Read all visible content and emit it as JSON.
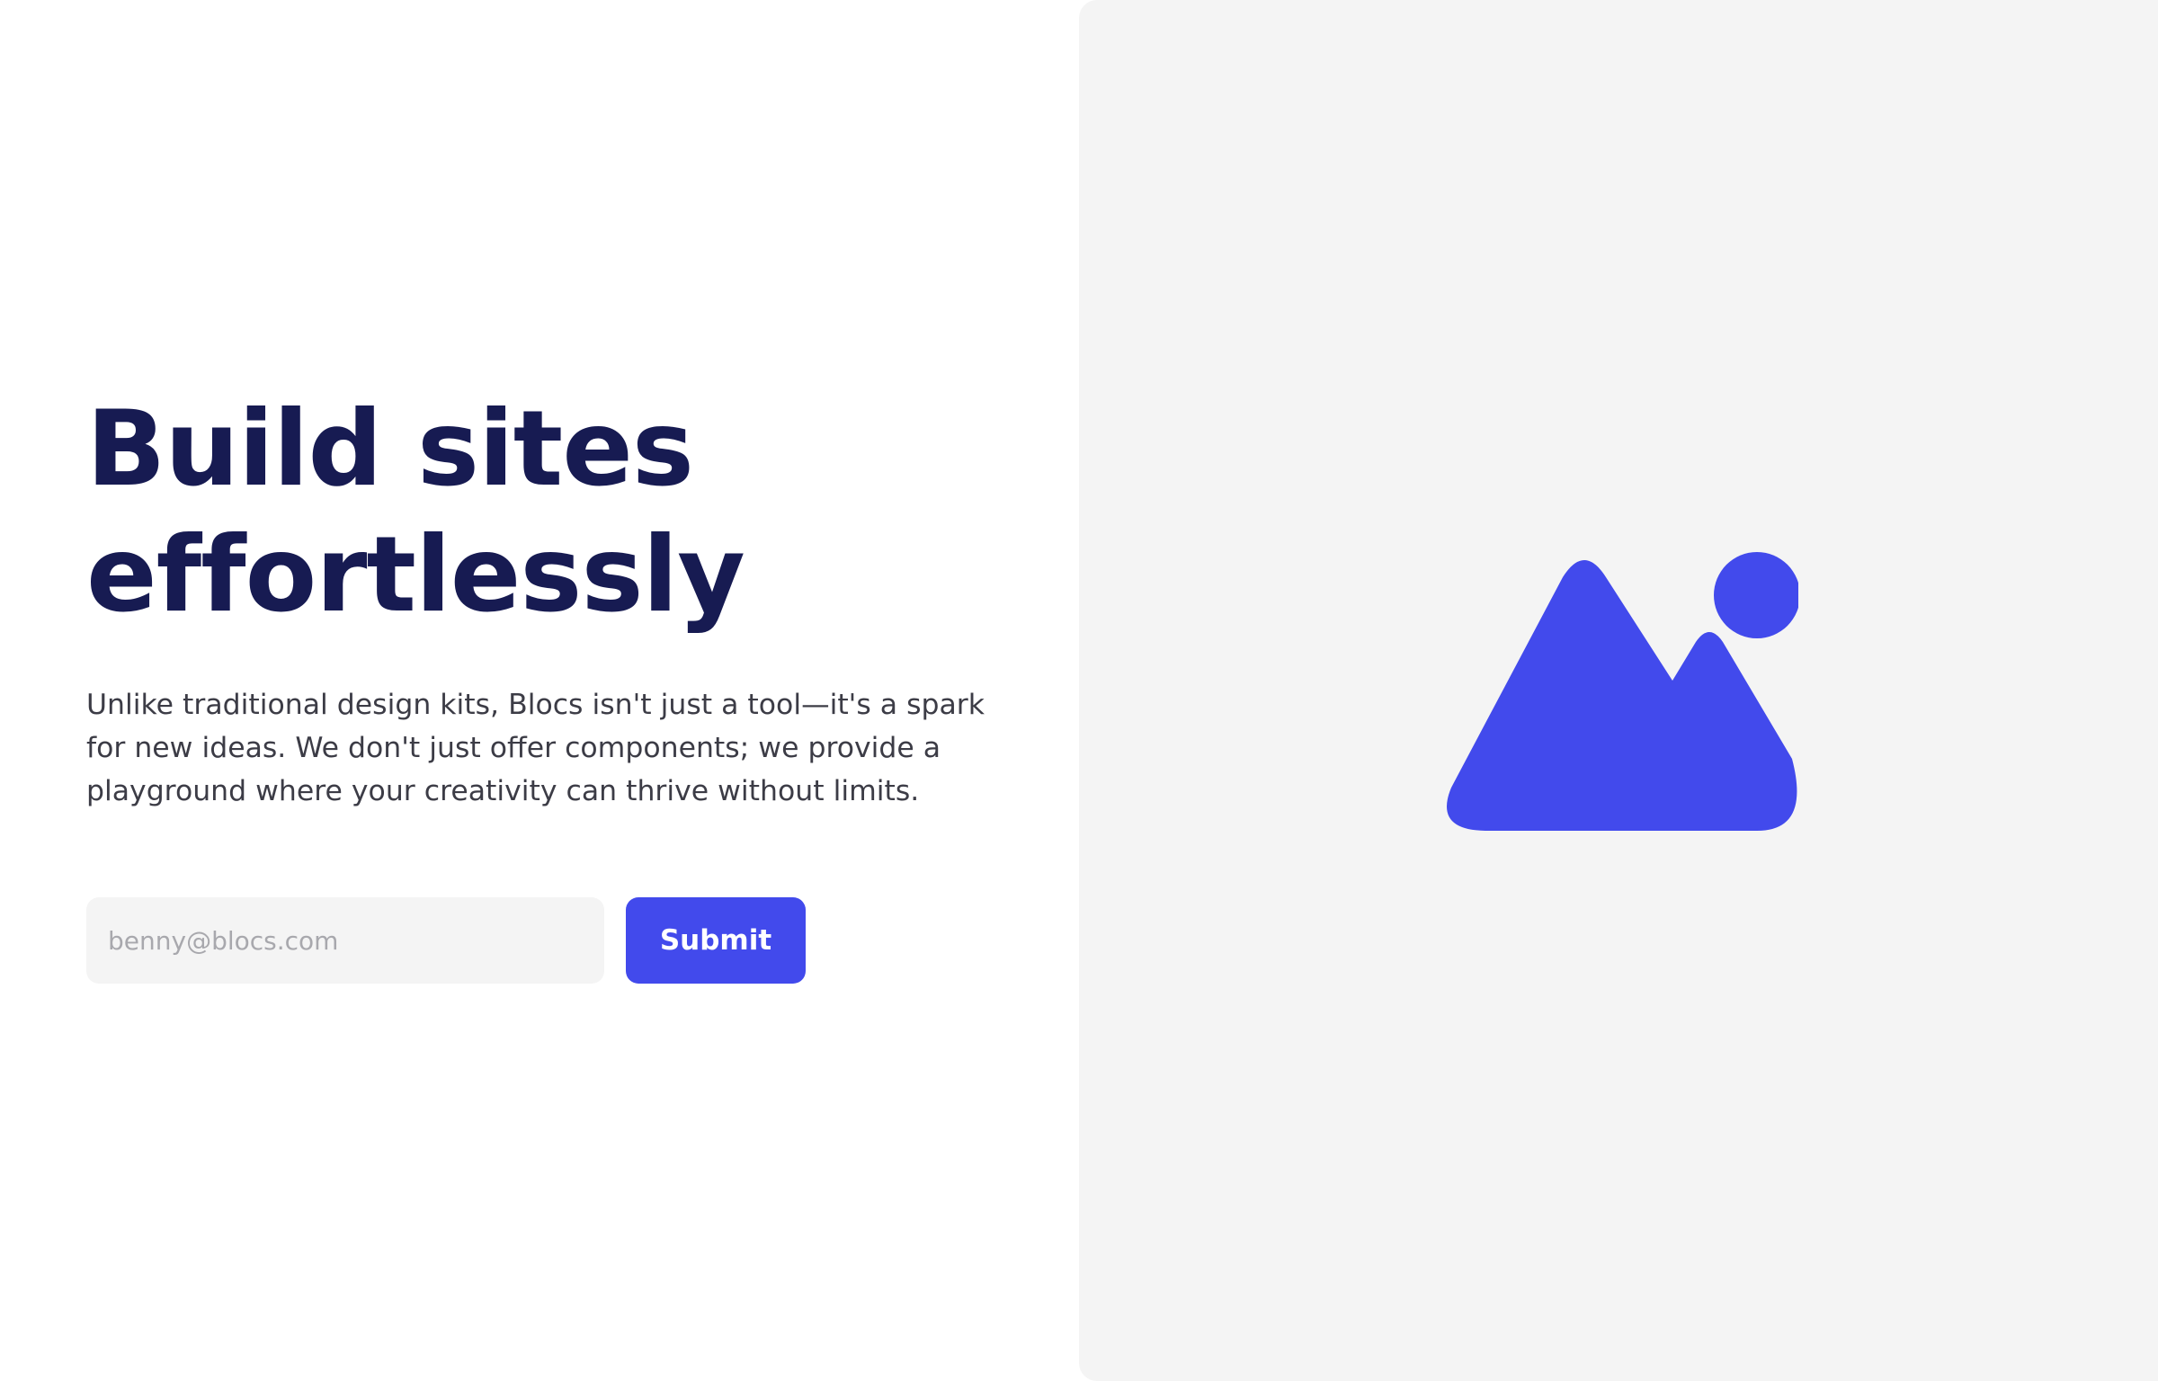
{
  "hero": {
    "headline_line1": "Build sites",
    "headline_line2": "effortlessly",
    "description": "Unlike traditional design kits, Blocs isn't just a tool—it's a spark for new ideas. We don't just offer components; we provide a playground where your creativity can thrive without limits."
  },
  "form": {
    "email_placeholder": "benny@blocs.com",
    "email_value": "",
    "submit_label": "Submit"
  },
  "media": {
    "icon": "image-placeholder-icon",
    "background_color": "#f4f4f4",
    "icon_color": "#424aec"
  },
  "colors": {
    "headline": "#171b52",
    "body_text": "#3c3c46",
    "accent": "#424aec",
    "input_background": "#f4f4f4"
  }
}
